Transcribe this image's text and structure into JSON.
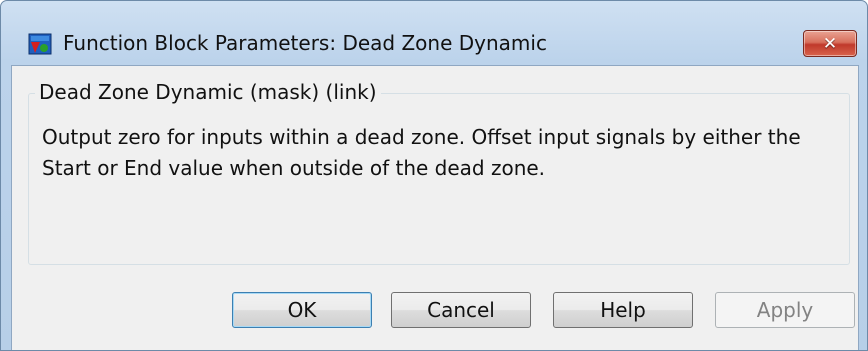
{
  "window": {
    "title": "Function Block Parameters: Dead Zone Dynamic",
    "close_label": "✕"
  },
  "group": {
    "legend": "Dead Zone Dynamic (mask) (link)",
    "description": "Output zero for inputs within a dead zone.  Offset input signals by either the Start or End value when outside of the dead zone."
  },
  "buttons": {
    "ok": "OK",
    "cancel": "Cancel",
    "help": "Help",
    "apply": "Apply"
  },
  "icons": {
    "app": "simulink-block-icon",
    "close": "close-icon"
  }
}
